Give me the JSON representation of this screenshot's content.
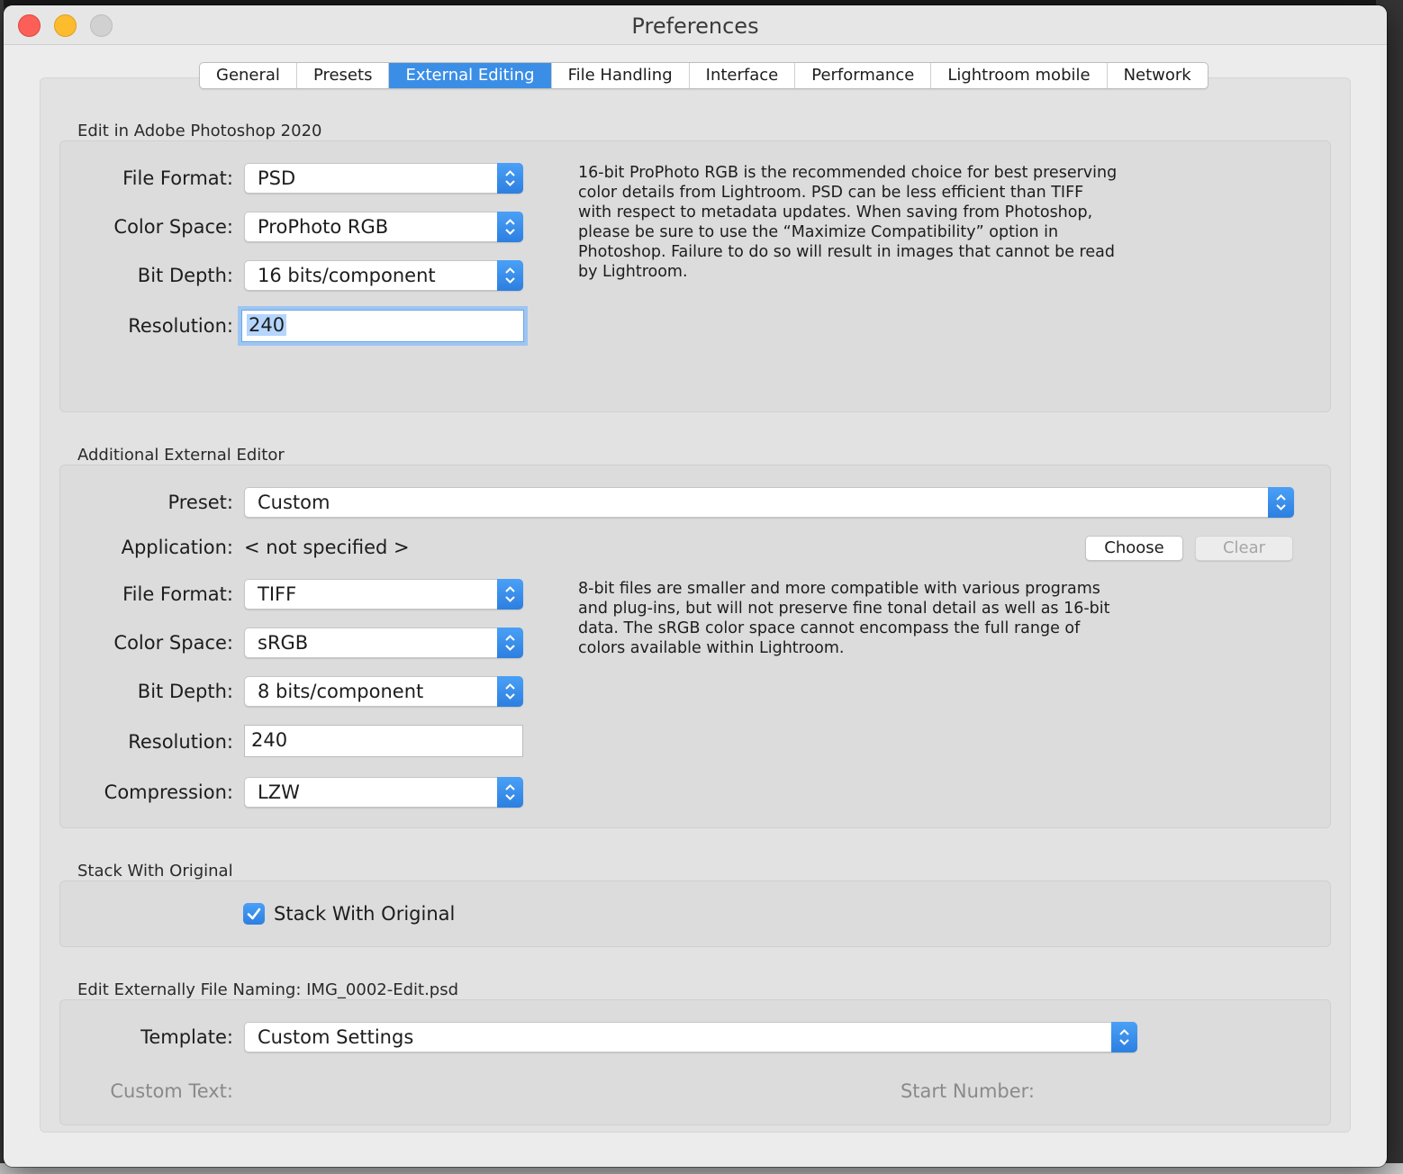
{
  "window": {
    "title": "Preferences"
  },
  "tabs": [
    {
      "label": "General",
      "active": false
    },
    {
      "label": "Presets",
      "active": false
    },
    {
      "label": "External Editing",
      "active": true
    },
    {
      "label": "File Handling",
      "active": false
    },
    {
      "label": "Interface",
      "active": false
    },
    {
      "label": "Performance",
      "active": false
    },
    {
      "label": "Lightroom mobile",
      "active": false
    },
    {
      "label": "Network",
      "active": false
    }
  ],
  "photoshop": {
    "section_title": "Edit in Adobe Photoshop 2020",
    "file_format_label": "File Format:",
    "file_format": "PSD",
    "color_space_label": "Color Space:",
    "color_space": "ProPhoto RGB",
    "bit_depth_label": "Bit Depth:",
    "bit_depth": "16 bits/component",
    "resolution_label": "Resolution:",
    "resolution": "240",
    "help_lines": [
      "16-bit ProPhoto RGB is the recommended choice for best preserving",
      "color details from Lightroom. PSD can be less efficient than TIFF",
      "with respect to metadata updates. When saving from Photoshop,",
      "please be sure to use the “Maximize Compatibility” option in",
      "Photoshop. Failure to do so will result in images that cannot be read",
      "by Lightroom."
    ]
  },
  "additional": {
    "section_title": "Additional External Editor",
    "preset_label": "Preset:",
    "preset": "Custom",
    "application_label": "Application:",
    "application": "< not specified >",
    "choose_label": "Choose",
    "clear_label": "Clear",
    "file_format_label": "File Format:",
    "file_format": "TIFF",
    "color_space_label": "Color Space:",
    "color_space": "sRGB",
    "bit_depth_label": "Bit Depth:",
    "bit_depth": "8 bits/component",
    "resolution_label": "Resolution:",
    "resolution": "240",
    "compression_label": "Compression:",
    "compression": "LZW",
    "help_lines": [
      "8-bit files are smaller and more compatible with various programs",
      "and plug-ins, but will not preserve fine tonal detail as well as 16-bit",
      "data. The sRGB color space cannot encompass the full range of",
      "colors available within Lightroom."
    ]
  },
  "stack": {
    "section_title": "Stack With Original",
    "checkbox_label": "Stack With Original",
    "checked": true
  },
  "naming": {
    "section_title": "Edit Externally File Naming:  IMG_0002-Edit.psd",
    "template_label": "Template:",
    "template": "Custom Settings",
    "custom_text_label": "Custom Text:",
    "start_number_label": "Start Number:"
  },
  "colors": {
    "accent": "#3a8ee6",
    "close": "#fc5f57",
    "minimize": "#fdbc2e",
    "zoom": "#d1d1d1"
  }
}
